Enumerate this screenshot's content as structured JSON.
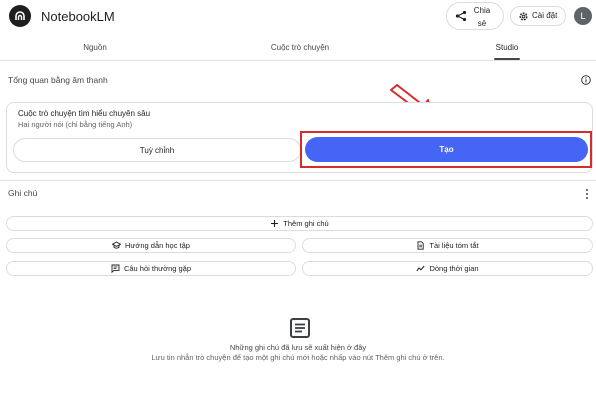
{
  "header": {
    "app_title": "NotebookLM",
    "share_label": "Chia sẻ",
    "settings_label": "Cài đặt",
    "avatar_initial": "L"
  },
  "tabs": [
    {
      "label": "Nguồn"
    },
    {
      "label": "Cuộc trò chuyện"
    },
    {
      "label": "Studio",
      "selected": true
    }
  ],
  "audio_overview": {
    "title": "Tổng quan bằng âm thanh",
    "card_title": "Cuộc trò chuyện tìm hiểu chuyên sâu",
    "card_subtitle": "Hai người nói (chỉ bằng tiếng Anh)",
    "customize_label": "Tuỳ chỉnh",
    "generate_label": "Tạo"
  },
  "notes": {
    "title": "Ghi chú",
    "add_note_label": "Thêm ghi chú",
    "study_guide_label": "Hướng dẫn học tập",
    "briefing_doc_label": "Tài liệu tóm tắt",
    "faq_label": "Câu hỏi thường gặp",
    "timeline_label": "Dòng thời gian",
    "empty_title": "Những ghi chú đã lưu sẽ xuất hiện ở đây",
    "empty_subtitle": "Lưu tin nhắn trò chuyện để tạo một ghi chú mới hoặc nhấp vào nút Thêm ghi chú ở trên."
  },
  "colors": {
    "accent": "#4565f5",
    "annotation_red": "#d62b2b"
  },
  "icons": [
    "notebooklm-logo-icon",
    "share-icon",
    "gear-icon",
    "info-icon",
    "more-vert-icon",
    "plus-icon",
    "school-icon",
    "document-icon",
    "faq-icon",
    "timeline-icon",
    "notes-icon",
    "red-arrow-icon"
  ]
}
